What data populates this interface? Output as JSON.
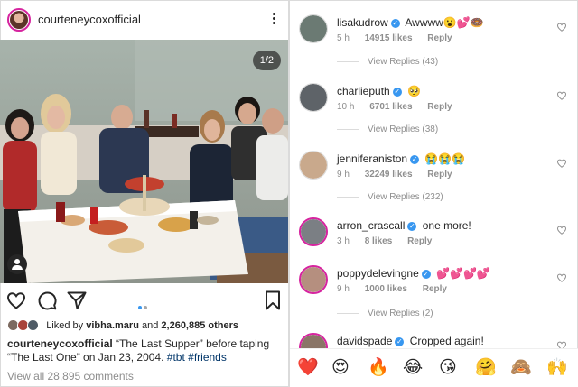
{
  "post": {
    "username": "courteneycoxofficial",
    "photo_counter": "1/2",
    "liked_prefix": "Liked by",
    "liked_user": "vibha.maru",
    "liked_and": "and",
    "liked_count": "2,260,885 others",
    "caption_user": "courteneycoxofficial",
    "caption_text": "“The Last Supper” before taping “The Last One” on Jan 23, 2004.",
    "hashtag_1": "#tbt",
    "hashtag_2": "#friends",
    "view_all_comments": "View all 28,895 comments",
    "carousel": {
      "total": 2,
      "active": 1
    },
    "icons": [
      "more-icon",
      "heart-icon",
      "comment-icon",
      "share-icon",
      "bookmark-icon",
      "tag-people-icon"
    ]
  },
  "comments": [
    {
      "user": "lisakudrow",
      "verified": true,
      "text": "Awwww😮💕🍩",
      "time": "5 h",
      "likes": "14915 likes",
      "reply": "Reply",
      "view_replies": "View Replies (43)",
      "avatar_color": "#6b7a73"
    },
    {
      "user": "charlieputh",
      "verified": true,
      "text": "🥺",
      "time": "10 h",
      "likes": "6701 likes",
      "reply": "Reply",
      "view_replies": "View Replies (38)",
      "avatar_color": "#5e6368"
    },
    {
      "user": "jenniferaniston",
      "verified": true,
      "text": "😭😭😭",
      "time": "9 h",
      "likes": "32249 likes",
      "reply": "Reply",
      "view_replies": "View Replies (232)",
      "avatar_color": "#c9a98c"
    },
    {
      "user": "arron_crascall",
      "verified": true,
      "text": "one more!",
      "time": "3 h",
      "likes": "8 likes",
      "reply": "Reply",
      "view_replies": "",
      "avatar_color": "#7b7f84"
    },
    {
      "user": "poppydelevingne",
      "verified": true,
      "text": "💕💕💕💕",
      "time": "9 h",
      "likes": "1000 likes",
      "reply": "Reply",
      "view_replies": "View Replies (2)",
      "avatar_color": "#b58f7f"
    },
    {
      "user": "davidspade",
      "verified": true,
      "text": "Cropped again!",
      "time": "",
      "likes": "",
      "reply": "",
      "view_replies": "",
      "avatar_color": "#8a7567"
    }
  ],
  "emoji_bar": [
    "❤️",
    "😍",
    "🔥",
    "😂",
    "😘",
    "🤗",
    "🙈",
    "🙌"
  ],
  "colors": {
    "link_blue": "#3897f0",
    "hashtag": "#003569",
    "muted": "#8e8e8e",
    "story_ring": "#d6249f",
    "border": "#dbdbdb"
  }
}
